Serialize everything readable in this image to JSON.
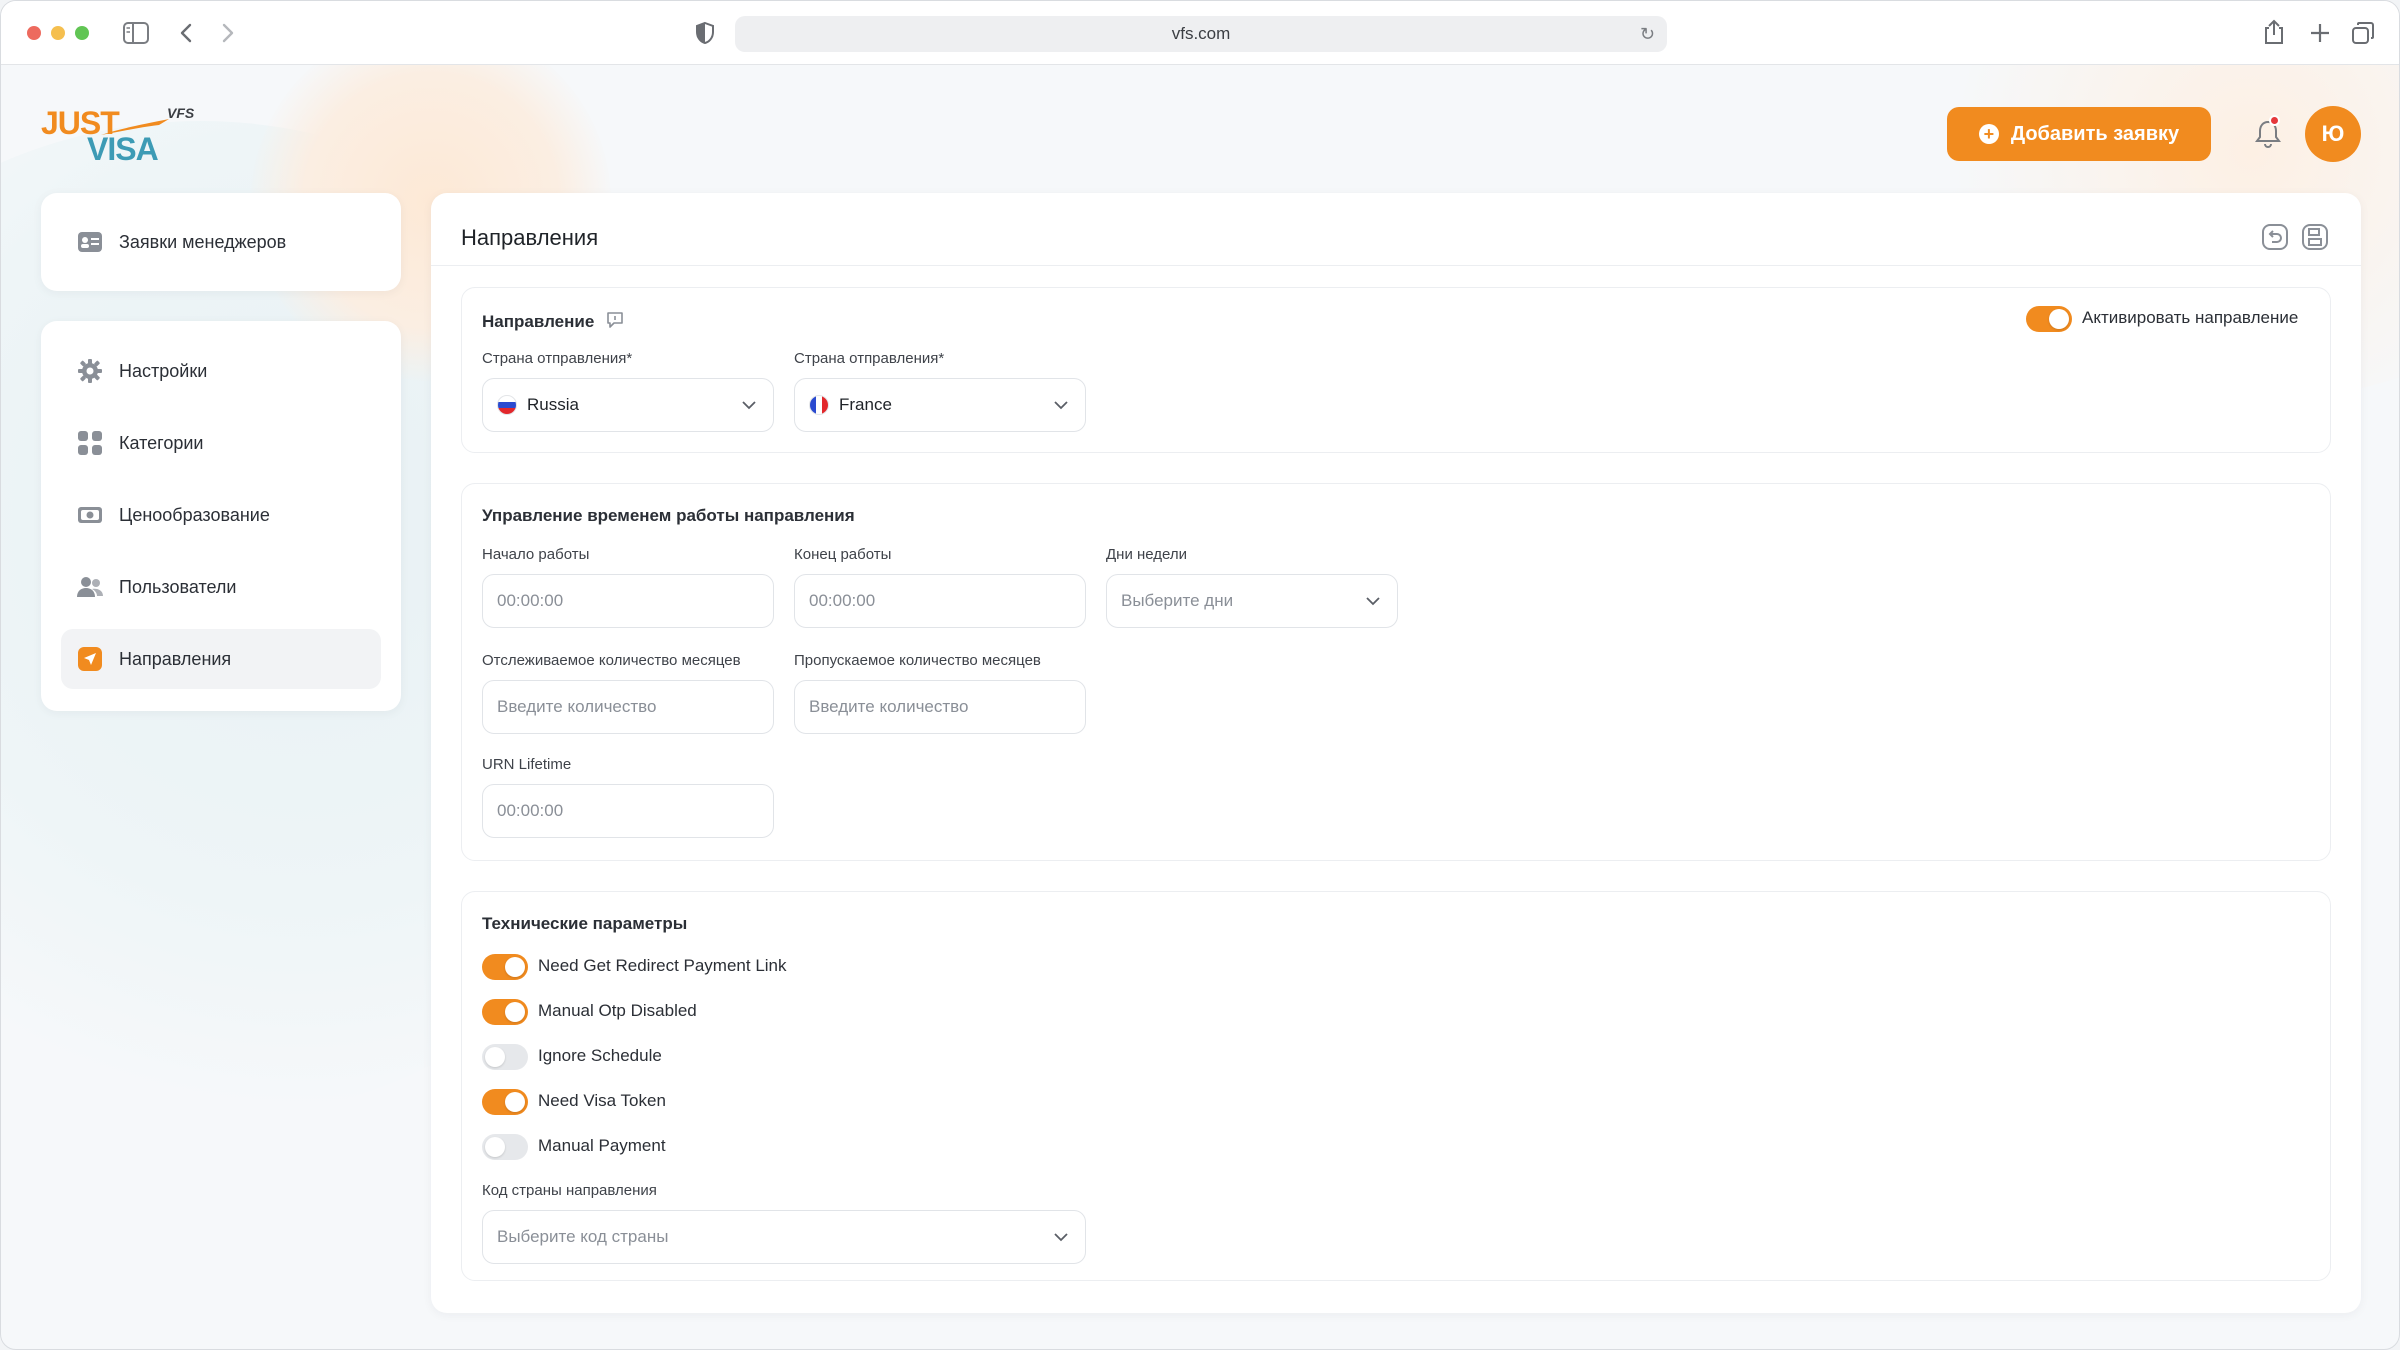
{
  "browser": {
    "url": "vfs.com"
  },
  "brand": {
    "logo_just": "JUST",
    "logo_visa": "VISA",
    "logo_vfs": "VFS",
    "accent": "#f18b1f",
    "secondary": "#3d9bb5"
  },
  "header": {
    "add_button_label": "Добавить заявку",
    "avatar_initial": "Ю"
  },
  "sidebar": {
    "top_items": [
      {
        "label": "Заявки менеджеров",
        "icon": "id-card-icon"
      }
    ],
    "items": [
      {
        "label": "Настройки",
        "icon": "gear-icon"
      },
      {
        "label": "Категории",
        "icon": "grid-icon"
      },
      {
        "label": "Ценообразование",
        "icon": "money-icon"
      },
      {
        "label": "Пользователи",
        "icon": "users-icon"
      },
      {
        "label": "Направления",
        "icon": "paper-plane-icon",
        "active": true
      }
    ]
  },
  "main": {
    "title": "Направления",
    "direction": {
      "title": "Направление",
      "activate_label": "Активировать направление",
      "activate_on": true,
      "from_label": "Страна отправления*",
      "from_value": "Russia",
      "to_label": "Страна отправления*",
      "to_value": "France"
    },
    "schedule": {
      "title": "Управление временем работы направления",
      "start_label": "Начало работы",
      "start_placeholder": "00:00:00",
      "end_label": "Конец работы",
      "end_placeholder": "00:00:00",
      "days_label": "Дни недели",
      "days_placeholder": "Выберите дни",
      "tracked_label": "Отслеживаемое количество месяцев",
      "tracked_placeholder": "Введите количество",
      "skipped_label": "Пропускаемое количество месяцев",
      "skipped_placeholder": "Введите количество",
      "urn_label": "URN Lifetime",
      "urn_placeholder": "00:00:00"
    },
    "tech": {
      "title": "Технические параметры",
      "toggles": [
        {
          "label": "Need Get Redirect Payment Link",
          "on": true
        },
        {
          "label": "Manual Otp Disabled",
          "on": true
        },
        {
          "label": "Ignore Schedule",
          "on": false
        },
        {
          "label": "Need Visa Token",
          "on": true
        },
        {
          "label": "Manual Payment",
          "on": false
        }
      ],
      "country_code_label": "Код страны направления",
      "country_code_placeholder": "Выберите код страны"
    }
  }
}
